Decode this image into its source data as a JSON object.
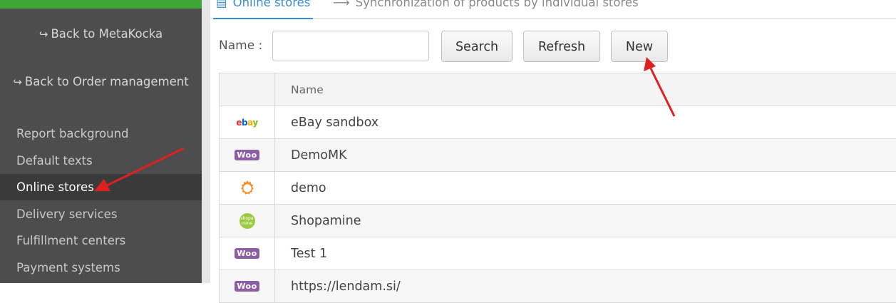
{
  "sidebar": {
    "back_links": [
      {
        "label": "Back to MetaKocka",
        "icon": "sign-out-icon"
      },
      {
        "label": "Back to Order management",
        "icon": "sign-out-icon"
      }
    ],
    "items": [
      {
        "label": "Report background"
      },
      {
        "label": "Default texts"
      },
      {
        "label": "Online stores",
        "active": true
      },
      {
        "label": "Delivery services"
      },
      {
        "label": "Fulfillment centers"
      },
      {
        "label": "Payment systems"
      }
    ]
  },
  "tabs": [
    {
      "label": "Online stores",
      "icon": "table-icon",
      "active": true
    },
    {
      "label": "Synchronization of products by individual stores",
      "icon": "arrow-right-icon"
    }
  ],
  "toolbar": {
    "name_label": "Name :",
    "name_value": "",
    "search_label": "Search",
    "refresh_label": "Refresh",
    "new_label": "New"
  },
  "table": {
    "header": "Name",
    "rows": [
      {
        "name": "eBay sandbox",
        "logo": "ebay-logo"
      },
      {
        "name": "DemoMK",
        "logo": "woocommerce-logo"
      },
      {
        "name": "demo",
        "logo": "gear-logo"
      },
      {
        "name": "Shopamine",
        "logo": "shopamine-logo"
      },
      {
        "name": "Test 1",
        "logo": "woocommerce-logo"
      },
      {
        "name": "https://lendam.si/",
        "logo": "woocommerce-logo"
      }
    ]
  },
  "logos": {
    "woo_text": "Woo",
    "ebay_letters": [
      "e",
      "b",
      "a",
      "y"
    ],
    "shopamine_text": "shopa mine"
  },
  "colors": {
    "accent": "#3c8dcd",
    "sidebar_bg": "#4d4d4d",
    "brand_green": "#3fa535",
    "annotation_arrow": "#e02020"
  }
}
